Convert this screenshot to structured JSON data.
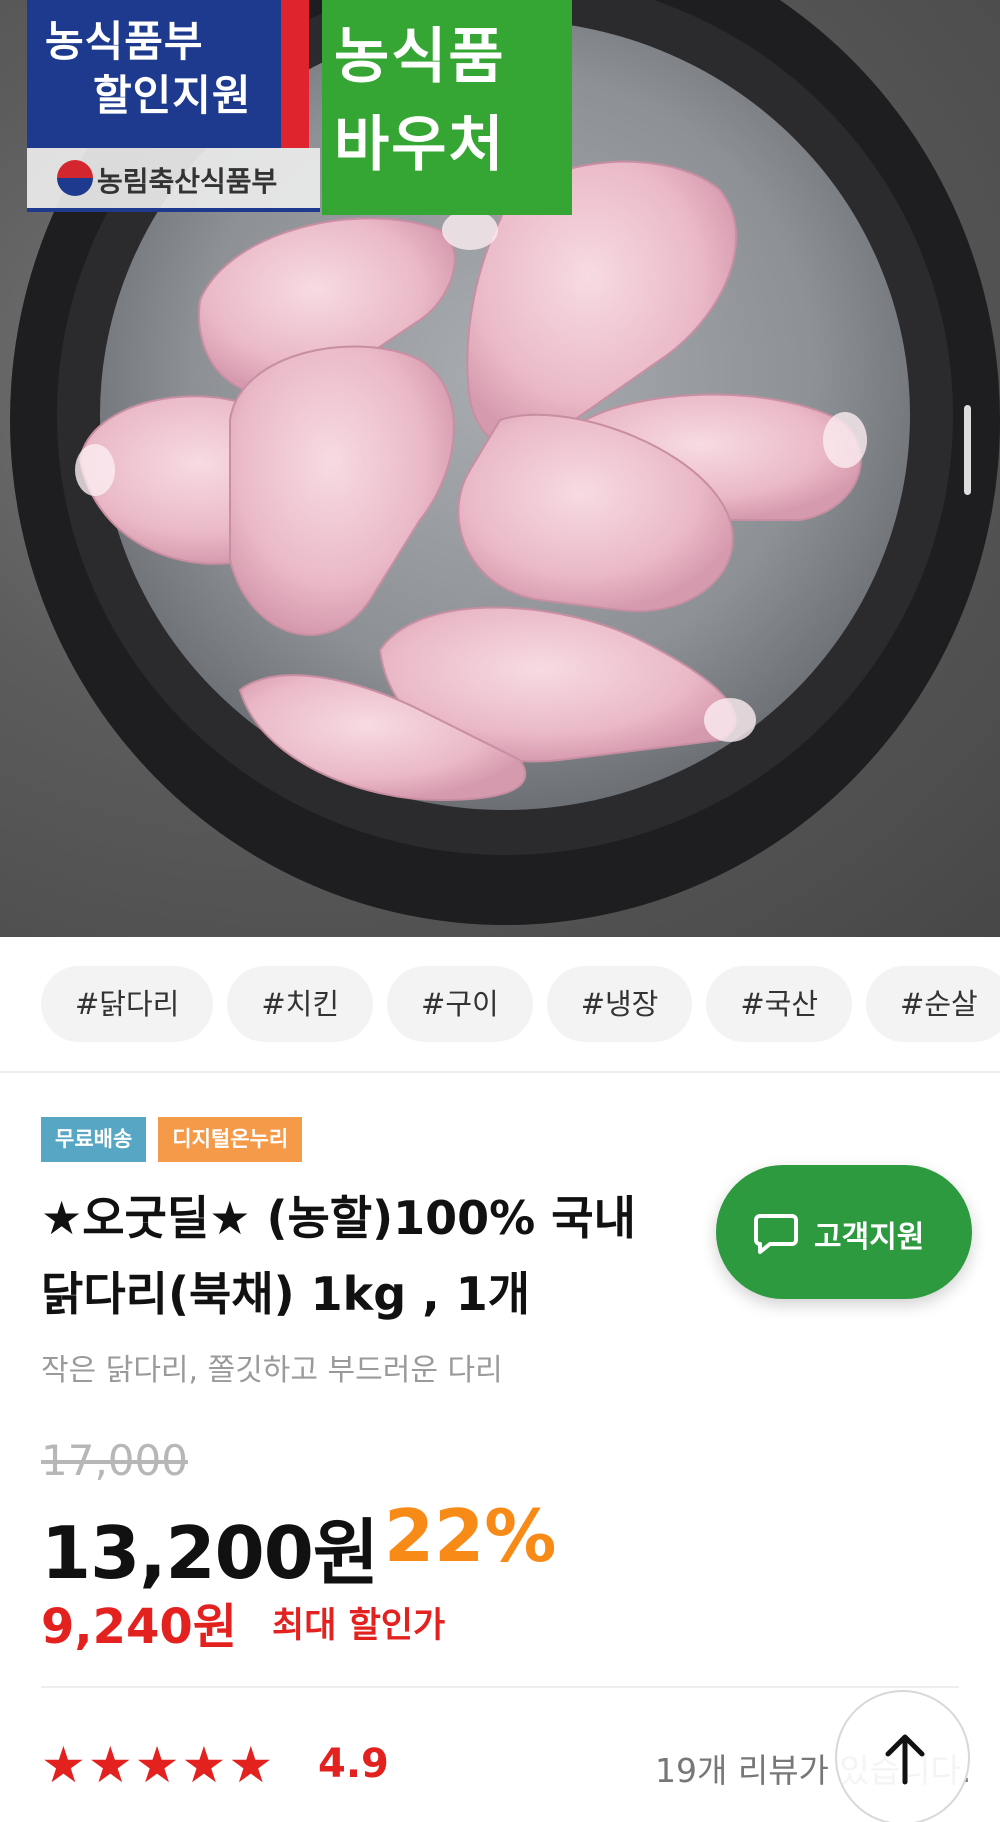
{
  "hero": {
    "badge_gov": {
      "line1": "농식품부",
      "line2": "할인지원",
      "ministry": "농림축산식품부"
    },
    "badge_voucher": {
      "line1": "농식품",
      "line2": "바우처"
    }
  },
  "tags": [
    "#닭다리",
    "#치킨",
    "#구이",
    "#냉장",
    "#국산",
    "#순살"
  ],
  "labels": {
    "free_shipping": "무료배송",
    "onnuri": "디지털온누리"
  },
  "product": {
    "title_line1": "★오굿딜★ (농할)100% 국내",
    "title_line2": "닭다리(북채) 1kg , 1개",
    "subtitle": "작은 닭다리, 쫄깃하고 부드러운 다리",
    "original_price": "17,000",
    "sale_price": "13,200원",
    "discount": "22%",
    "max_discount_price": "9,240원",
    "max_discount_label": "최대 할인가",
    "rating": "4.9",
    "stars": 5,
    "review_text": "19개 리뷰가 있습니다."
  },
  "support_button": {
    "label": "고객지원",
    "icon": "chat-bubble-icon"
  },
  "scroll_top_button": {
    "icon": "arrow-up-icon"
  },
  "colors": {
    "accent_green": "#2e9a3f",
    "price_red": "#e3211f",
    "discount_orange": "#f88b17",
    "label_blue": "#57a6c4",
    "label_orange": "#f59a49"
  }
}
